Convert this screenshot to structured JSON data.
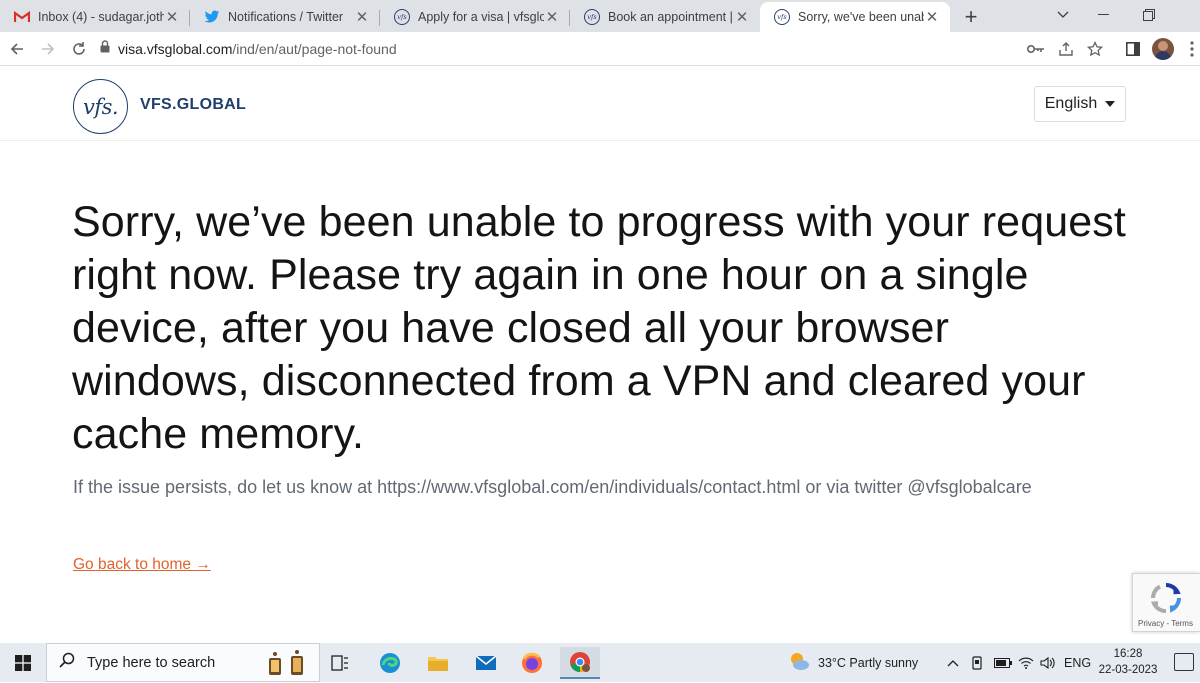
{
  "browser": {
    "tabs": [
      {
        "title": "Inbox (4) - sudagar.jothi@",
        "icon": "gmail-icon"
      },
      {
        "title": "Notifications / Twitter",
        "icon": "twitter-icon"
      },
      {
        "title": "Apply for a visa | vfsgloba",
        "icon": "vfs-favicon"
      },
      {
        "title": "Book an appointment | vf",
        "icon": "vfs-favicon"
      },
      {
        "title": "Sorry, we've been unable",
        "icon": "vfs-favicon",
        "active": true
      }
    ],
    "new_tab_label": "+",
    "url_host": "visa.vfsglobal.com",
    "url_path": "/ind/en/aut/page-not-found"
  },
  "page": {
    "logo_mark": "vfs.",
    "logo_text": "VFS.GLOBAL",
    "language": "English",
    "heading": "Sorry, we’ve been unable to progress with your request right now. Please try again in one hour on a single device, after you have closed all your browser windows, disconnected from a VPN and cleared your cache memory.",
    "subtext": "If the issue persists, do let us know at https://www.vfsglobal.com/en/individuals/contact.html or via twitter @vfsglobalcare",
    "home_link": "Go back to home →",
    "recaptcha_links": "Privacy - Terms"
  },
  "taskbar": {
    "search_placeholder": "Type here to search",
    "weather": "33°C  Partly sunny",
    "language": "ENG",
    "time": "16:28",
    "date": "22-03-2023"
  },
  "colors": {
    "brand_navy": "#1f3f6b",
    "link_orange": "#e0622c"
  }
}
